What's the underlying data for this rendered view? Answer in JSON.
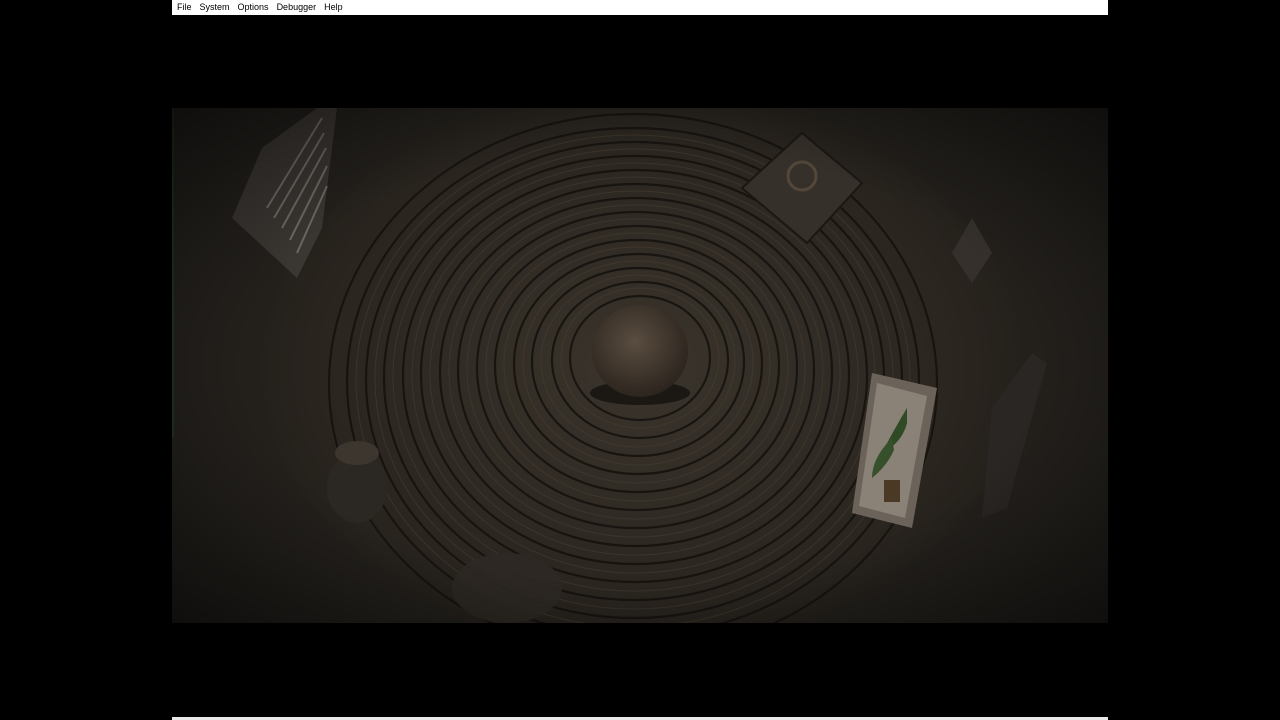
{
  "menubar": {
    "items": [
      {
        "label": "File"
      },
      {
        "label": "System"
      },
      {
        "label": "Options"
      },
      {
        "label": "Debugger"
      },
      {
        "label": "Help"
      }
    ]
  },
  "scene": {
    "description_colors": {
      "background": "#1e1b17",
      "sand": "#2f2a24",
      "stone": "#3e352c",
      "wall": "#262320"
    }
  }
}
